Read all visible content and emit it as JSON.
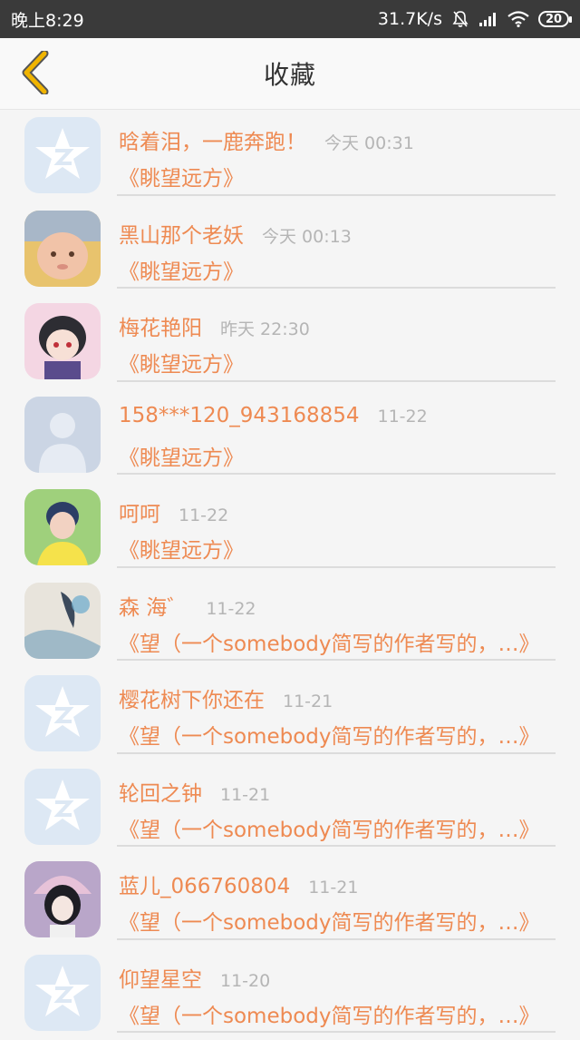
{
  "status_bar": {
    "time": "晚上8:29",
    "speed": "31.7K/s",
    "battery": "20",
    "icons": [
      "mute-bell-icon",
      "signal-icon",
      "wifi-icon",
      "battery-icon"
    ]
  },
  "header": {
    "title": "收藏",
    "back_icon": "chevron-left-icon"
  },
  "colors": {
    "accent": "#ee8a52",
    "back_arrow": "#f0b400",
    "time_text": "#b5b5b5",
    "status_bar_bg": "#3a3a3a"
  },
  "items": [
    {
      "name": "晗着泪，一鹿奔跑！",
      "time": "今天 00:31",
      "quote": "《眺望远方》",
      "avatar": "qzone-star"
    },
    {
      "name": "黑山那个老妖",
      "time": "今天 00:13",
      "quote": "《眺望远方》",
      "avatar": "baby-photo"
    },
    {
      "name": "梅花艳阳",
      "time": "昨天 22:30",
      "quote": "《眺望远方》",
      "avatar": "anime-photo"
    },
    {
      "name": "158***120_943168854",
      "time": "11-22",
      "quote": "《眺望远方》",
      "avatar": "default-person"
    },
    {
      "name": "呵呵",
      "time": "11-22",
      "quote": "《眺望远方》",
      "avatar": "girl-photo"
    },
    {
      "name": "森 海゛",
      "time": "11-22",
      "quote": "《望（一个somebody简写的作者写的，…》",
      "avatar": "painting-photo"
    },
    {
      "name": "樱花树下你还在",
      "time": "11-21",
      "quote": "《望（一个somebody简写的作者写的，…》",
      "avatar": "qzone-star"
    },
    {
      "name": "轮回之钟",
      "time": "11-21",
      "quote": "《望（一个somebody简写的作者写的，…》",
      "avatar": "qzone-star"
    },
    {
      "name": "蓝儿_066760804",
      "time": "11-21",
      "quote": "《望（一个somebody简写的作者写的，…》",
      "avatar": "doll-photo"
    },
    {
      "name": "仰望星空",
      "time": "11-20",
      "quote": "《望（一个somebody简写的作者写的，…》",
      "avatar": "qzone-star"
    }
  ]
}
